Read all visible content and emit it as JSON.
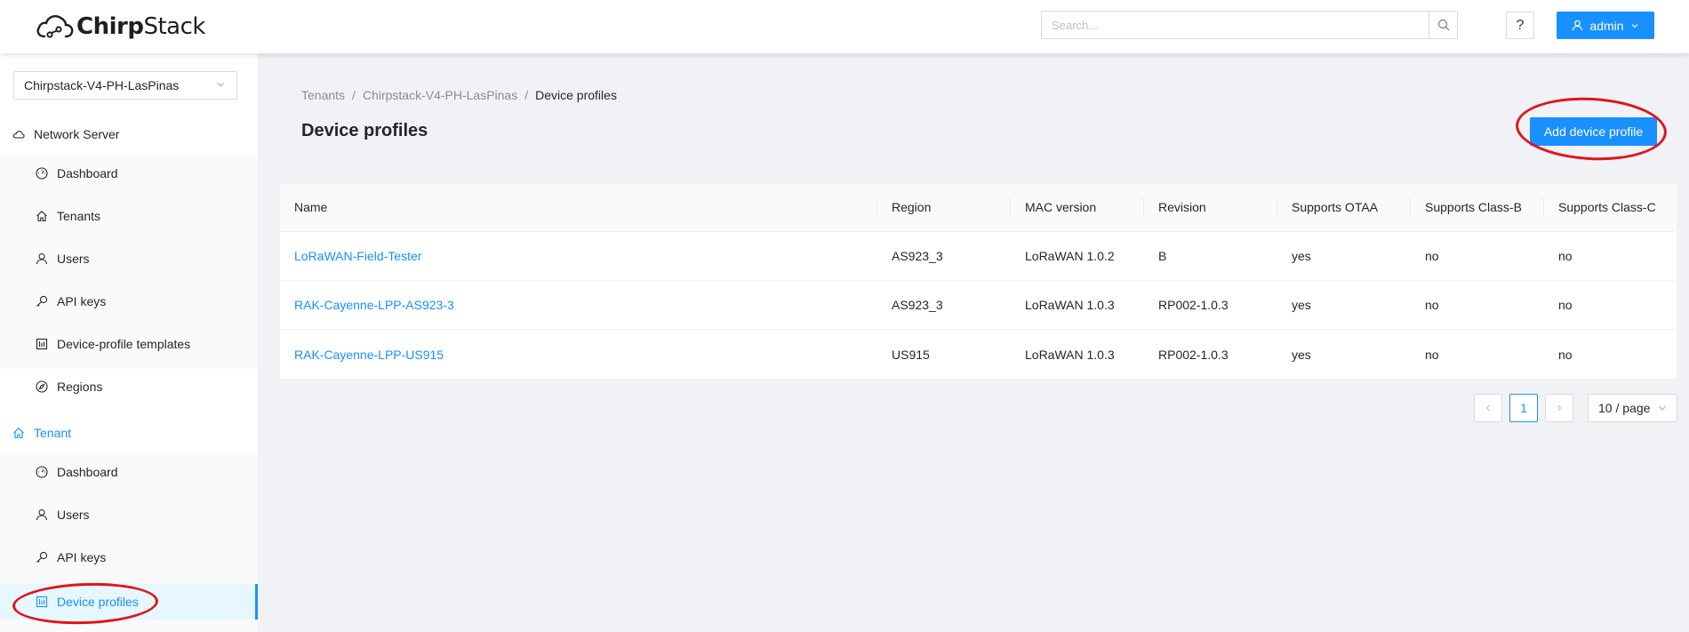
{
  "header": {
    "logo_text_bold": "Chirp",
    "logo_text_rest": "Stack",
    "search_placeholder": "Search...",
    "help_label": "?",
    "user_label": "admin"
  },
  "sidebar": {
    "tenant_select": "Chirpstack-V4-PH-LasPinas",
    "network_server": {
      "label": "Network Server",
      "items": [
        {
          "label": "Dashboard",
          "icon": "dashboard-icon"
        },
        {
          "label": "Tenants",
          "icon": "home-icon"
        },
        {
          "label": "Users",
          "icon": "user-icon"
        },
        {
          "label": "API keys",
          "icon": "key-icon"
        },
        {
          "label": "Device-profile templates",
          "icon": "template-icon"
        },
        {
          "label": "Regions",
          "icon": "compass-icon"
        }
      ]
    },
    "tenant": {
      "label": "Tenant",
      "items": [
        {
          "label": "Dashboard",
          "icon": "dashboard-icon"
        },
        {
          "label": "Users",
          "icon": "user-icon"
        },
        {
          "label": "API keys",
          "icon": "key-icon"
        },
        {
          "label": "Device profiles",
          "icon": "template-icon",
          "selected": true
        }
      ]
    }
  },
  "breadcrumb": [
    "Tenants",
    "Chirpstack-V4-PH-LasPinas",
    "Device profiles"
  ],
  "page_title": "Device profiles",
  "add_button_label": "Add device profile",
  "table": {
    "columns": [
      "Name",
      "Region",
      "MAC version",
      "Revision",
      "Supports OTAA",
      "Supports Class-B",
      "Supports Class-C"
    ],
    "rows": [
      [
        "LoRaWAN-Field-Tester",
        "AS923_3",
        "LoRaWAN 1.0.2",
        "B",
        "yes",
        "no",
        "no"
      ],
      [
        "RAK-Cayenne-LPP-AS923-3",
        "AS923_3",
        "LoRaWAN 1.0.3",
        "RP002-1.0.3",
        "yes",
        "no",
        "no"
      ],
      [
        "RAK-Cayenne-LPP-US915",
        "US915",
        "LoRaWAN 1.0.3",
        "RP002-1.0.3",
        "yes",
        "no",
        "no"
      ]
    ]
  },
  "pagination": {
    "current_page": "1",
    "page_size": "10 / page"
  },
  "colors": {
    "accent": "#1890ff",
    "annotation": "#e0141c"
  }
}
